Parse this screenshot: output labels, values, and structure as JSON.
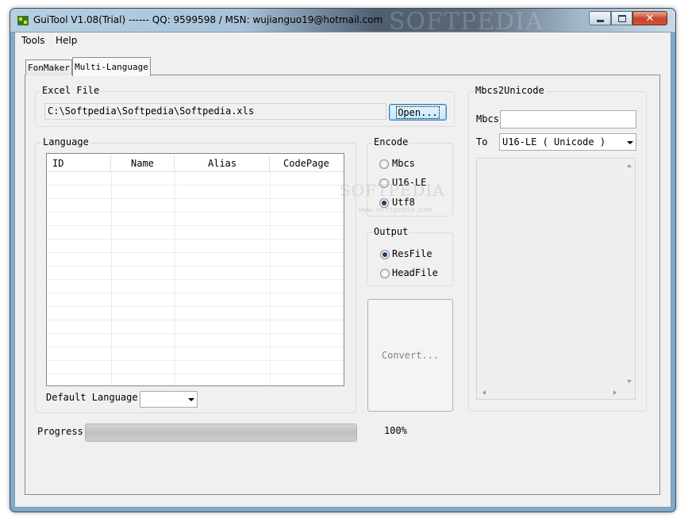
{
  "window": {
    "title": "GuiTool V1.08(Trial) ------ QQ: 9599598 / MSN: wujianguo19@hotmail.com",
    "watermark": "SOFTPEDIA"
  },
  "menu": {
    "items": [
      "Tools",
      "Help"
    ]
  },
  "tabs": [
    {
      "label": "FonMaker",
      "active": false
    },
    {
      "label": "Multi-Language",
      "active": true
    }
  ],
  "excel": {
    "group_label": "Excel File",
    "path": "C:\\Softpedia\\Softpedia\\Softpedia.xls",
    "open_label": "Open..."
  },
  "language": {
    "group_label": "Language",
    "columns": [
      "ID",
      "Name",
      "Alias",
      "CodePage"
    ],
    "rows": [],
    "default_label": "Default Language",
    "default_value": ""
  },
  "encode": {
    "group_label": "Encode",
    "options": [
      "Mbcs",
      "U16-LE",
      "Utf8"
    ],
    "selected": "Utf8"
  },
  "output": {
    "group_label": "Output",
    "options": [
      "ResFile",
      "HeadFile"
    ],
    "selected": "ResFile"
  },
  "convert": {
    "label": "Convert...",
    "enabled": false
  },
  "progress": {
    "label": "Progress",
    "value_text": "100%",
    "value": 1.0
  },
  "mbcs2unicode": {
    "group_label": "Mbcs2Unicode",
    "mbcs_label": "Mbcs",
    "mbcs_value": "",
    "to_label": "To",
    "to_value": "U16-LE ( Unicode )"
  },
  "watermark_body": {
    "brand": "SOFTPEDIA",
    "url": "www.softpedia.com"
  },
  "colors": {
    "accent": "#3c7fb1",
    "close": "#c7442b",
    "selected_radio": "#1b3f6d"
  }
}
